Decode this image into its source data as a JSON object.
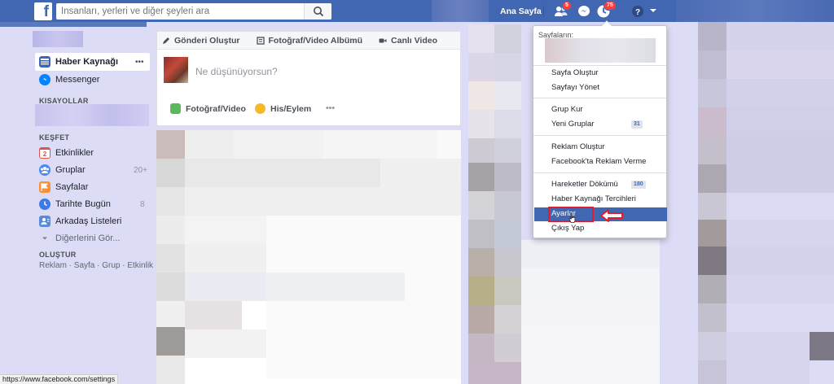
{
  "topbar": {
    "search_placeholder": "İnsanları, yerleri ve diğer şeyleri ara",
    "home_label": "Ana Sayfa",
    "friend_requests_badge": "5",
    "notifications_badge": "75"
  },
  "leftnav": {
    "news_feed": "Haber Kaynağı",
    "messenger": "Messenger",
    "shortcuts_header": "KISAYOLLAR",
    "explore_header": "KEŞFET",
    "explore_items": [
      {
        "label": "Etkinlikler",
        "count": ""
      },
      {
        "label": "Gruplar",
        "count": "20+"
      },
      {
        "label": "Sayfalar",
        "count": ""
      },
      {
        "label": "Tarihte Bugün",
        "count": "8"
      },
      {
        "label": "Arkadaş Listeleri",
        "count": ""
      },
      {
        "label": "Diğerlerini Gör...",
        "count": ""
      }
    ],
    "calendar_day": "2",
    "create_header": "OLUŞTUR",
    "create_links": "Reklam · Sayfa · Grup · Etkinlik"
  },
  "composer": {
    "tab_post": "Gönderi Oluştur",
    "tab_album": "Fotoğraf/Video Albümü",
    "tab_live": "Canlı Video",
    "placeholder": "Ne düşünüyorsun?",
    "action_photo": "Fotoğraf/Video",
    "action_feeling": "His/Eylem",
    "action_more": "•••"
  },
  "dropdown": {
    "pages_header": "Sayfaların:",
    "items": {
      "create_page": "Sayfa Oluştur",
      "manage_pages": "Sayfayı Yönet",
      "create_group": "Grup Kur",
      "new_groups": "Yeni Gruplar",
      "new_groups_count": "31",
      "create_ad": "Reklam Oluştur",
      "advertise": "Facebook'ta Reklam Verme",
      "activity_log": "Hareketler Dökümü",
      "activity_log_count": "180",
      "news_feed_prefs": "Haber Kaynağı Tercihleri",
      "settings": "Ayarlar",
      "logout": "Çıkış Yap"
    }
  },
  "statusbar": {
    "url": "https://www.facebook.com/settings"
  },
  "colors": {
    "brand": "#4267b2",
    "highlight_box": "#e01e2b",
    "background": "#dcdcf6"
  }
}
